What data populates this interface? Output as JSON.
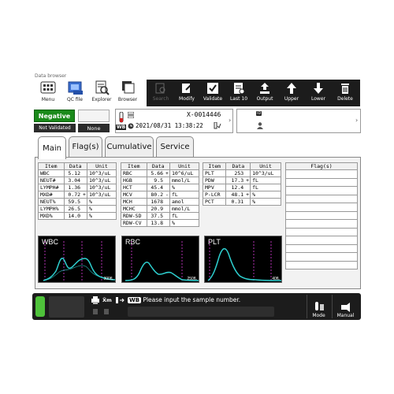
{
  "window_title": "Data browser",
  "toolbar_left": [
    {
      "label": "Menu",
      "icon": "menu-icon"
    },
    {
      "label": "QC file",
      "icon": "qc-file-icon"
    },
    {
      "label": "Explorer",
      "icon": "explorer-icon"
    },
    {
      "label": "Browser",
      "icon": "browser-icon"
    }
  ],
  "toolbar_right": [
    {
      "label": "Search",
      "icon": "search-icon",
      "enabled": false
    },
    {
      "label": "Modify",
      "icon": "modify-icon",
      "enabled": true
    },
    {
      "label": "Validate",
      "icon": "validate-icon",
      "enabled": true
    },
    {
      "label": "Last 10",
      "icon": "last10-icon",
      "enabled": true
    },
    {
      "label": "Output",
      "icon": "output-icon",
      "enabled": true
    },
    {
      "label": "Upper",
      "icon": "arrow-up-icon",
      "enabled": true
    },
    {
      "label": "Lower",
      "icon": "arrow-down-icon",
      "enabled": true
    },
    {
      "label": "Delete",
      "icon": "trash-icon",
      "enabled": true
    }
  ],
  "status": {
    "result": "Negative",
    "validation": "Not Validated",
    "flag": "None",
    "result_color": "#1a8a1a"
  },
  "sample": {
    "id": "X-0014446",
    "mode": "WB",
    "datetime": "2021/08/31 13:38:22"
  },
  "tabs": [
    "Main",
    "Flag(s)",
    "Cumulative",
    "Service"
  ],
  "active_tab": "Main",
  "wbc_table": {
    "headers": [
      "Item",
      "Data",
      "Unit"
    ],
    "rows": [
      [
        "WBC",
        "5.12",
        "",
        "10^3/uL"
      ],
      [
        "NEUT#",
        "3.04",
        "",
        "10^3/uL"
      ],
      [
        "LYMPH#",
        "1.36",
        "",
        "10^3/uL"
      ],
      [
        "MXD#",
        "0.72",
        "+",
        "10^3/uL"
      ],
      [
        "NEUT%",
        "59.5",
        "",
        "%"
      ],
      [
        "LYMPH%",
        "26.5",
        "",
        "%"
      ],
      [
        "MXD%",
        "14.0",
        "",
        "%"
      ]
    ]
  },
  "rbc_table": {
    "headers": [
      "Item",
      "Data",
      "Unit"
    ],
    "rows": [
      [
        "RBC",
        "5.66",
        "+",
        "10^6/uL"
      ],
      [
        "HGB",
        "9.5",
        "",
        "mmol/L"
      ],
      [
        "HCT",
        "45.4",
        "",
        "%"
      ],
      [
        "MCV",
        "80.2",
        "-",
        "fL"
      ],
      [
        "MCH",
        "1678",
        "",
        "amol"
      ],
      [
        "MCHC",
        "20.9",
        "",
        "mmol/L"
      ],
      [
        "RDW-SD",
        "37.5",
        "",
        "fL"
      ],
      [
        "RDW-CV",
        "13.8",
        "",
        "%"
      ]
    ]
  },
  "plt_table": {
    "headers": [
      "Item",
      "Data",
      "Unit"
    ],
    "rows": [
      [
        "PLT",
        "253",
        "",
        "10^3/uL"
      ],
      [
        "PDW",
        "17.3",
        "+",
        "fL"
      ],
      [
        "MPV",
        "12.4",
        "",
        "fL"
      ],
      [
        "P-LCR",
        "48.1",
        "+",
        "%"
      ],
      [
        "PCT",
        "0.31",
        "",
        "%"
      ]
    ]
  },
  "flags_table": {
    "header": "Flag(s)",
    "rows": 12
  },
  "histograms": [
    {
      "label": "WBC",
      "axis": "300fL"
    },
    {
      "label": "RBC",
      "axis": "250fL"
    },
    {
      "label": "PLT",
      "axis": "40fL"
    }
  ],
  "bottom": {
    "message": "Please input the sample number.",
    "mode_label": "WB",
    "buttons": [
      "Mode",
      "Manual"
    ],
    "led_color": "#4ec23a"
  }
}
